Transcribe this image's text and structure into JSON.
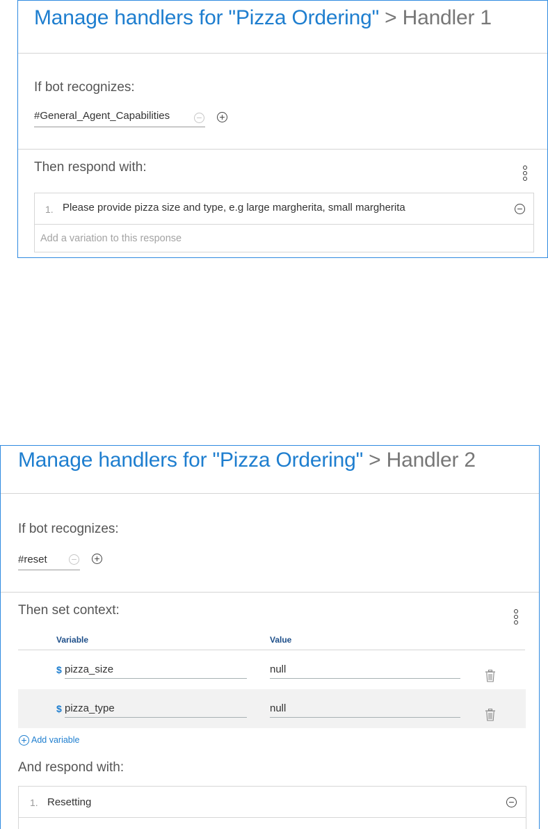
{
  "handler1": {
    "title_link": "Manage handlers for \"Pizza Ordering\"",
    "title_crumb": " > Handler 1",
    "if_label": "If bot recognizes:",
    "condition": "#General_Agent_Capabilities",
    "then_label": "Then respond with:",
    "responses": [
      {
        "number": "1.",
        "text": "Please provide pizza size and type, e.g large margherita, small margherita"
      }
    ],
    "variation_placeholder": "Add a variation to this response"
  },
  "handler2": {
    "title_link": "Manage handlers for \"Pizza Ordering\"",
    "title_crumb": " > Handler 2",
    "if_label": "If bot recognizes:",
    "condition": "#reset",
    "context_label": "Then set context:",
    "col_variable": "Variable",
    "col_value": "Value",
    "context_vars": [
      {
        "prefix": "$",
        "name": "pizza_size",
        "value": "null"
      },
      {
        "prefix": "$",
        "name": "pizza_type",
        "value": "null"
      }
    ],
    "add_variable": "Add variable",
    "and_label": "And respond with:",
    "responses": [
      {
        "number": "1.",
        "text": "Resetting"
      }
    ]
  },
  "icons": {
    "minus": "−",
    "plus": "+"
  }
}
